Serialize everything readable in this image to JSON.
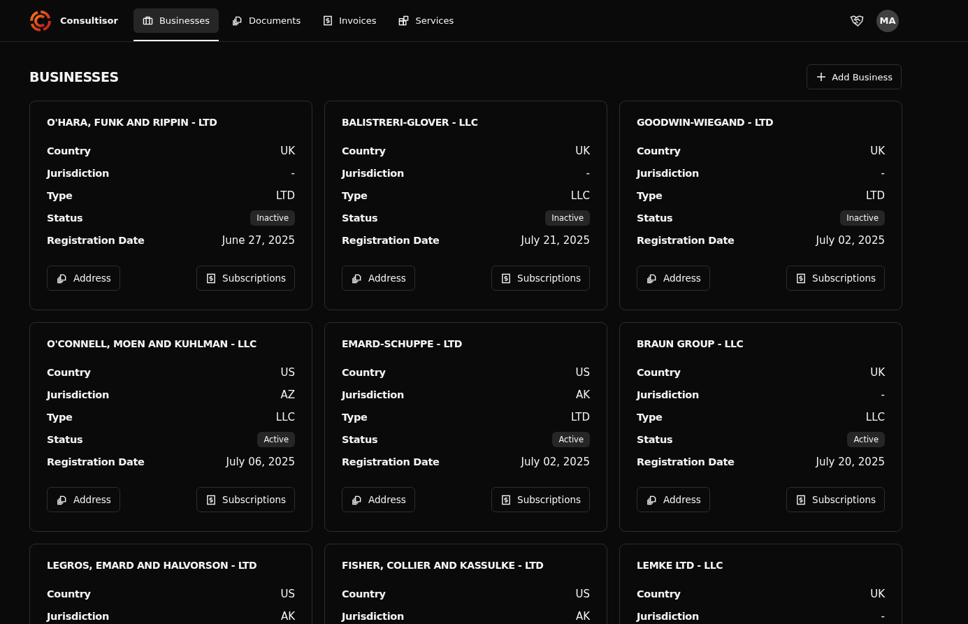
{
  "brand": {
    "name": "Consultisor"
  },
  "nav": [
    {
      "label": "Businesses",
      "selected": true
    },
    {
      "label": "Documents",
      "selected": false
    },
    {
      "label": "Invoices",
      "selected": false
    },
    {
      "label": "Services",
      "selected": false
    }
  ],
  "user": {
    "initials": "MA"
  },
  "page": {
    "title": "BUSINESSES",
    "action": "Add Business"
  },
  "businesses": [
    {
      "name": "O'HARA, FUNK AND RIPPIN - LTD",
      "fields": [
        {
          "label": "Country",
          "value": "UK",
          "kind": "text"
        },
        {
          "label": "Jurisdiction",
          "value": "-",
          "kind": "text"
        },
        {
          "label": "Type",
          "value": "LTD",
          "kind": "text"
        },
        {
          "label": "Status",
          "value": "Inactive",
          "kind": "badge"
        },
        {
          "label": "Registration Date",
          "value": "June 27, 2025",
          "kind": "text"
        }
      ],
      "buttons": [
        "Address",
        "Subscriptions"
      ]
    },
    {
      "name": "BALISTRERI-GLOVER - LLC",
      "fields": [
        {
          "label": "Country",
          "value": "UK",
          "kind": "text"
        },
        {
          "label": "Jurisdiction",
          "value": "-",
          "kind": "text"
        },
        {
          "label": "Type",
          "value": "LLC",
          "kind": "text"
        },
        {
          "label": "Status",
          "value": "Inactive",
          "kind": "badge"
        },
        {
          "label": "Registration Date",
          "value": "July 21, 2025",
          "kind": "text"
        }
      ],
      "buttons": [
        "Address",
        "Subscriptions"
      ]
    },
    {
      "name": "GOODWIN-WIEGAND - LTD",
      "fields": [
        {
          "label": "Country",
          "value": "UK",
          "kind": "text"
        },
        {
          "label": "Jurisdiction",
          "value": "-",
          "kind": "text"
        },
        {
          "label": "Type",
          "value": "LTD",
          "kind": "text"
        },
        {
          "label": "Status",
          "value": "Inactive",
          "kind": "badge"
        },
        {
          "label": "Registration Date",
          "value": "July 02, 2025",
          "kind": "text"
        }
      ],
      "buttons": [
        "Address",
        "Subscriptions"
      ]
    },
    {
      "name": "O'CONNELL, MOEN AND KUHLMAN - LLC",
      "fields": [
        {
          "label": "Country",
          "value": "US",
          "kind": "text"
        },
        {
          "label": "Jurisdiction",
          "value": "AZ",
          "kind": "text"
        },
        {
          "label": "Type",
          "value": "LLC",
          "kind": "text"
        },
        {
          "label": "Status",
          "value": "Active",
          "kind": "badge"
        },
        {
          "label": "Registration Date",
          "value": "July 06, 2025",
          "kind": "text"
        }
      ],
      "buttons": [
        "Address",
        "Subscriptions"
      ]
    },
    {
      "name": "EMARD-SCHUPPE - LTD",
      "fields": [
        {
          "label": "Country",
          "value": "US",
          "kind": "text"
        },
        {
          "label": "Jurisdiction",
          "value": "AK",
          "kind": "text"
        },
        {
          "label": "Type",
          "value": "LTD",
          "kind": "text"
        },
        {
          "label": "Status",
          "value": "Active",
          "kind": "badge"
        },
        {
          "label": "Registration Date",
          "value": "July 02, 2025",
          "kind": "text"
        }
      ],
      "buttons": [
        "Address",
        "Subscriptions"
      ]
    },
    {
      "name": "BRAUN GROUP - LLC",
      "fields": [
        {
          "label": "Country",
          "value": "UK",
          "kind": "text"
        },
        {
          "label": "Jurisdiction",
          "value": "-",
          "kind": "text"
        },
        {
          "label": "Type",
          "value": "LLC",
          "kind": "text"
        },
        {
          "label": "Status",
          "value": "Active",
          "kind": "badge"
        },
        {
          "label": "Registration Date",
          "value": "July 20, 2025",
          "kind": "text"
        }
      ],
      "buttons": [
        "Address",
        "Subscriptions"
      ]
    },
    {
      "name": "LEGROS, EMARD AND HALVORSON - LTD",
      "fields": [
        {
          "label": "Country",
          "value": "US",
          "kind": "text"
        },
        {
          "label": "Jurisdiction",
          "value": "AK",
          "kind": "text"
        }
      ]
    },
    {
      "name": "FISHER, COLLIER AND KASSULKE - LTD",
      "fields": [
        {
          "label": "Country",
          "value": "US",
          "kind": "text"
        },
        {
          "label": "Jurisdiction",
          "value": "AK",
          "kind": "text"
        }
      ]
    },
    {
      "name": "LEMKE LTD - LLC",
      "fields": [
        {
          "label": "Country",
          "value": "UK",
          "kind": "text"
        },
        {
          "label": "Jurisdiction",
          "value": "-",
          "kind": "text"
        }
      ]
    }
  ]
}
